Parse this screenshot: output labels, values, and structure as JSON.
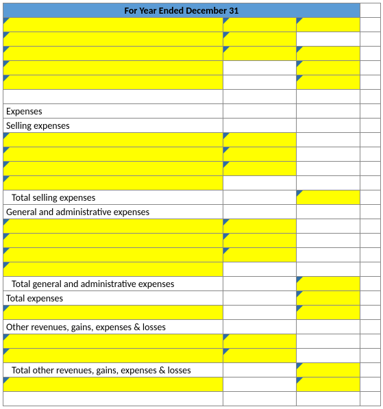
{
  "header": {
    "title": "For Year Ended December 31"
  },
  "labels": {
    "expenses": "Expenses",
    "selling": "Selling expenses",
    "total_selling": "Total selling expenses",
    "ga": "General and administrative expenses",
    "total_ga": "Total general and administrative expenses",
    "total_exp": "Total expenses",
    "other": "Other revenues, gains, expenses & losses",
    "total_other": "Total other revenues, gains, expenses & losses"
  }
}
